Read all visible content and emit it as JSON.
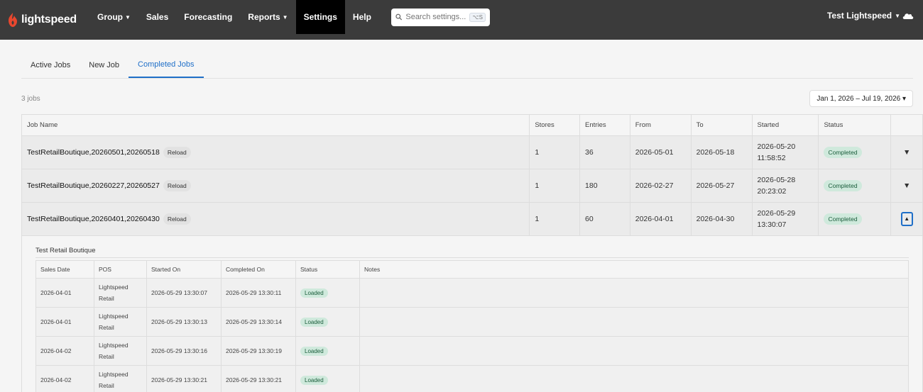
{
  "brand": {
    "name": "lightspeed",
    "color": "#e8472e"
  },
  "nav": {
    "items": [
      {
        "label": "Group",
        "caret": true
      },
      {
        "label": "Sales",
        "caret": false
      },
      {
        "label": "Forecasting",
        "caret": false
      },
      {
        "label": "Reports",
        "caret": true
      },
      {
        "label": "Settings",
        "caret": false,
        "active": true
      },
      {
        "label": "Help",
        "caret": false
      }
    ],
    "search_placeholder": "Search settings...",
    "search_shortcut": "⌥S",
    "user": "Test Lightspeed"
  },
  "tabs": [
    {
      "label": "Active Jobs"
    },
    {
      "label": "New Job"
    },
    {
      "label": "Completed Jobs",
      "active": true
    }
  ],
  "toolbar": {
    "count": "3 jobs",
    "date_range": "Jan 1, 2026 – Jul 19, 2026 ▾"
  },
  "jobs": {
    "headers": [
      "Job Name",
      "Stores",
      "Entries",
      "From",
      "To",
      "Started",
      "Status"
    ],
    "rows": [
      {
        "name": "TestRetailBoutique,20260501,20260518",
        "reload": "Reload",
        "stores": "1",
        "entries": "36",
        "from": "2026-05-01",
        "to": "2026-05-18",
        "started_date": "2026-05-20",
        "started_time": "11:58:52",
        "status": "Completed",
        "toggle": "▼"
      },
      {
        "name": "TestRetailBoutique,20260227,20260527",
        "reload": "Reload",
        "stores": "1",
        "entries": "180",
        "from": "2026-02-27",
        "to": "2026-05-27",
        "started_date": "2026-05-28",
        "started_time": "20:23:02",
        "status": "Completed",
        "toggle": "▼"
      },
      {
        "name": "TestRetailBoutique,20260401,20260430",
        "reload": "Reload",
        "stores": "1",
        "entries": "60",
        "from": "2026-04-01",
        "to": "2026-04-30",
        "started_date": "2026-05-29",
        "started_time": "13:30:07",
        "status": "Completed",
        "toggle": "▲"
      }
    ]
  },
  "detail": {
    "title": "Test Retail Boutique",
    "headers": [
      "Sales Date",
      "POS",
      "Started On",
      "Completed On",
      "Status",
      "Notes"
    ],
    "rows": [
      {
        "sales_date": "2026-04-01",
        "pos_line1": "Lightspeed",
        "pos_line2": "Retail",
        "started_on": "2026-05-29 13:30:07",
        "completed_on": "2026-05-29 13:30:11",
        "status": "Loaded",
        "notes": ""
      },
      {
        "sales_date": "2026-04-01",
        "pos_line1": "Lightspeed",
        "pos_line2": "Retail",
        "started_on": "2026-05-29 13:30:13",
        "completed_on": "2026-05-29 13:30:14",
        "status": "Loaded",
        "notes": ""
      },
      {
        "sales_date": "2026-04-02",
        "pos_line1": "Lightspeed",
        "pos_line2": "Retail",
        "started_on": "2026-05-29 13:30:16",
        "completed_on": "2026-05-29 13:30:19",
        "status": "Loaded",
        "notes": ""
      },
      {
        "sales_date": "2026-04-02",
        "pos_line1": "Lightspeed",
        "pos_line2": "Retail",
        "started_on": "2026-05-29 13:30:21",
        "completed_on": "2026-05-29 13:30:21",
        "status": "Loaded",
        "notes": ""
      }
    ]
  }
}
